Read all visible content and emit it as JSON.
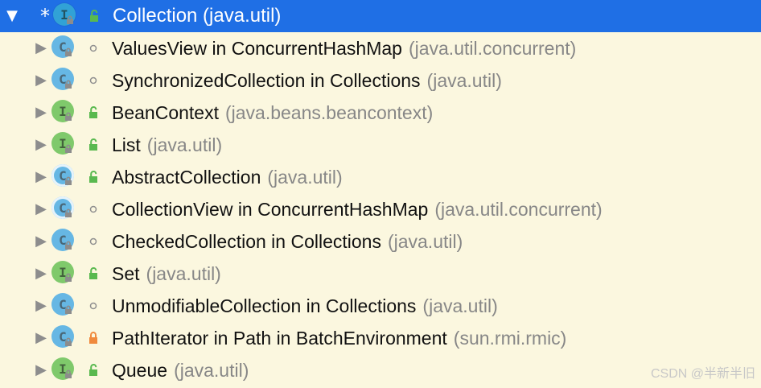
{
  "tree": {
    "root": {
      "toggle_icon": "triangle-down-icon",
      "marker": "*",
      "kind_icon": "interface-icon",
      "kind_label": "I",
      "visibility_icon": "public-lock-icon",
      "label": "Collection (java.util)"
    },
    "items": [
      {
        "name": "ValuesView in ConcurrentHashMap",
        "package": "(java.util.concurrent)",
        "kind_icon": "class-icon",
        "kind_label": "C",
        "visibility_icon": "package-private-icon"
      },
      {
        "name": "SynchronizedCollection in Collections",
        "package": "(java.util)",
        "kind_icon": "class-icon",
        "kind_label": "C",
        "visibility_icon": "package-private-icon"
      },
      {
        "name": "BeanContext",
        "package": "(java.beans.beancontext)",
        "kind_icon": "interface-icon",
        "kind_label": "I",
        "visibility_icon": "public-lock-icon"
      },
      {
        "name": "List",
        "package": "(java.util)",
        "kind_icon": "interface-icon",
        "kind_label": "I",
        "visibility_icon": "public-lock-icon"
      },
      {
        "name": "AbstractCollection",
        "package": "(java.util)",
        "kind_icon": "abstract-class-icon",
        "kind_label": "C",
        "visibility_icon": "public-lock-icon"
      },
      {
        "name": "CollectionView in ConcurrentHashMap",
        "package": "(java.util.concurrent)",
        "kind_icon": "abstract-class-icon",
        "kind_label": "C",
        "visibility_icon": "package-private-icon"
      },
      {
        "name": "CheckedCollection in Collections",
        "package": "(java.util)",
        "kind_icon": "class-icon",
        "kind_label": "C",
        "visibility_icon": "package-private-icon"
      },
      {
        "name": "Set",
        "package": "(java.util)",
        "kind_icon": "interface-icon",
        "kind_label": "I",
        "visibility_icon": "public-lock-icon"
      },
      {
        "name": "UnmodifiableCollection in Collections",
        "package": "(java.util)",
        "kind_icon": "class-icon",
        "kind_label": "C",
        "visibility_icon": "package-private-icon"
      },
      {
        "name": "PathIterator in Path in BatchEnvironment",
        "package": "(sun.rmi.rmic)",
        "kind_icon": "class-icon",
        "kind_label": "C",
        "visibility_icon": "private-lock-icon"
      },
      {
        "name": "Queue",
        "package": "(java.util)",
        "kind_icon": "interface-icon",
        "kind_label": "I",
        "visibility_icon": "public-lock-icon"
      }
    ]
  },
  "watermark": "CSDN @半新半旧",
  "colors": {
    "selection_background": "#1f6fe5",
    "row_background": "#fbf7df",
    "interface_badge": "#7fc96b",
    "class_badge": "#66b7e4",
    "public_lock": "#59b94f",
    "private_lock": "#f08a3d",
    "package_private_dot": "#8f8f8f",
    "primary_text": "#111111",
    "secondary_text": "#878787"
  }
}
